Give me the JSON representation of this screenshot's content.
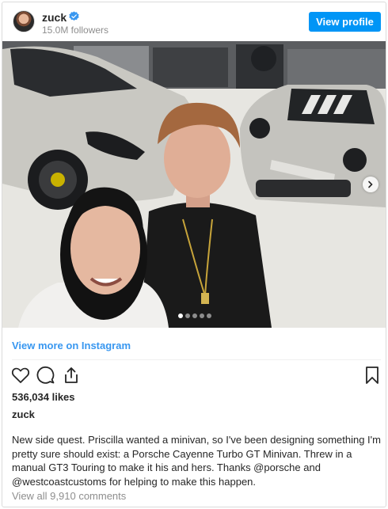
{
  "header": {
    "username": "zuck",
    "followers": "15.0M followers",
    "view_profile_label": "View profile"
  },
  "post": {
    "image_alt": "Selfie of two people in a garage with two grey Porsche cars",
    "carousel": {
      "total": 5,
      "active_index": 0
    },
    "view_more_label": "View more on Instagram",
    "likes": "536,034 likes",
    "caption_username": "zuck",
    "caption_text": "New side quest. Priscilla wanted a minivan, so I've been designing something I'm pretty sure should exist: a Porsche Cayenne Turbo GT Minivan. Threw in a manual GT3 Touring to make it his and hers. Thanks @porsche and @westcoastcustoms for helping to make this happen.",
    "comments_label": "View all 9,910 comments"
  },
  "icons": {
    "verified": "verified-badge-icon",
    "like": "heart-icon",
    "comment": "comment-icon",
    "share": "share-icon",
    "save": "bookmark-icon",
    "next": "chevron-right-icon"
  },
  "colors": {
    "accent": "#0095f6",
    "link": "#3897f0",
    "muted": "#8e8e8e",
    "text": "#262626"
  }
}
